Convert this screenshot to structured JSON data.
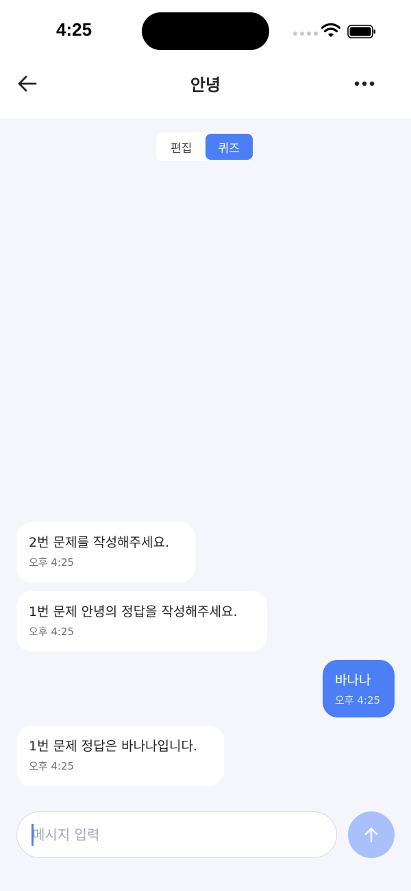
{
  "status_bar": {
    "time": "4:25"
  },
  "header": {
    "title": "안녕"
  },
  "segment": {
    "edit_label": "편집",
    "quiz_label": "퀴즈",
    "selected": "퀴즈"
  },
  "messages": [
    {
      "sender": "bot",
      "text": "2번 문제를 작성해주세요.",
      "time": "오후 4:25"
    },
    {
      "sender": "bot",
      "text": "1번 문제 안녕의 정답을 작성해주세요.",
      "time": "오후 4:25"
    },
    {
      "sender": "user",
      "text": "바나나",
      "time": "오후 4:25"
    },
    {
      "sender": "bot",
      "text": "1번 문제 정답은 바나나입니다.",
      "time": "오후 4:25"
    }
  ],
  "composer": {
    "placeholder": "메시지 입력",
    "value": ""
  },
  "colors": {
    "accent": "#4c7ef5",
    "send_disabled": "#a9c0fb",
    "background": "#f4f6fb"
  }
}
